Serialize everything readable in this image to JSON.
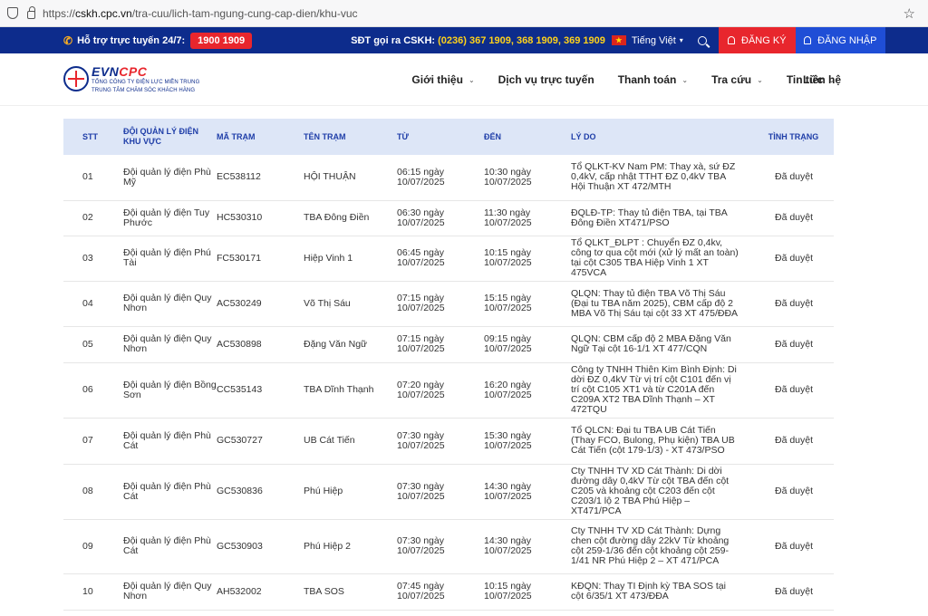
{
  "browser": {
    "url_prefix": "https://",
    "url_domain": "cskh.cpc.vn",
    "url_path": "/tra-cuu/lich-tam-ngung-cung-cap-dien/khu-vuc"
  },
  "topbar": {
    "support_label": "Hỗ trợ trực tuyến 24/7:",
    "hotline": "1900 1909",
    "cskh_label": "SĐT gọi ra CSKH:",
    "cskh_numbers": "(0236) 367 1909, 368 1909, 369 1909",
    "language": "Tiếng Việt",
    "register": "ĐĂNG KÝ",
    "login": "ĐĂNG NHẬP"
  },
  "header": {
    "logo_evn": "EVN",
    "logo_cpc": "CPC",
    "logo_line1": "TỔNG CÔNG TY ĐIỆN LỰC MIỀN TRUNG",
    "logo_line2": "TRUNG TÂM CHĂM SÓC KHÁCH HÀNG",
    "nav": [
      "Giới thiệu",
      "Dịch vụ trực tuyến",
      "Thanh toán",
      "Tra cứu",
      "Tin tức",
      "Liên hệ"
    ]
  },
  "table": {
    "headers": {
      "stt": "STT",
      "doi": "ĐỘI QUẢN LÝ ĐIỆN KHU VỰC",
      "ma": "MÃ TRẠM",
      "ten": "TÊN TRẠM",
      "tu": "TỪ",
      "den": "ĐẾN",
      "ly_do": "LÝ DO",
      "tinh_trang": "TÌNH TRẠNG"
    },
    "rows": [
      {
        "stt": "01",
        "doi": "Đội quản lý điện Phù Mỹ",
        "ma": "EC538112",
        "ten": "HỘI THUẬN",
        "tu": "06:15 ngày 10/07/2025",
        "den": "10:30 ngày 10/07/2025",
        "ly_do": "Tổ QLKT-KV Nam PM: Thay xà, sứ ĐZ 0,4kV, cấp nhật TTHT ĐZ 0,4kV TBA Hội Thuận XT 472/MTH",
        "tinh_trang": "Đã duyệt"
      },
      {
        "stt": "02",
        "doi": "Đội quản lý điện Tuy Phước",
        "ma": "HC530310",
        "ten": "TBA Đông Điền",
        "tu": "06:30 ngày 10/07/2025",
        "den": "11:30 ngày 10/07/2025",
        "ly_do": "ĐQLĐ-TP: Thay tủ điện TBA, tại TBA Đông Điền XT471/PSO",
        "tinh_trang": "Đã duyệt"
      },
      {
        "stt": "03",
        "doi": "Đội quản lý điện Phú Tài",
        "ma": "FC530171",
        "ten": "Hiệp Vinh 1",
        "tu": "06:45 ngày 10/07/2025",
        "den": "10:15 ngày 10/07/2025",
        "ly_do": "Tổ QLKT_ĐLPT : Chuyển ĐZ 0,4kv, công tơ qua cột mới (xử lý mất an toàn) tại cột C305 TBA Hiệp Vinh 1 XT 475VCA",
        "tinh_trang": "Đã duyệt"
      },
      {
        "stt": "04",
        "doi": "Đội quản lý điện Quy Nhơn",
        "ma": "AC530249",
        "ten": "Võ Thị Sáu",
        "tu": "07:15 ngày 10/07/2025",
        "den": "15:15 ngày 10/07/2025",
        "ly_do": "QLQN: Thay tủ điện TBA Võ Thị Sáu (Đại tu TBA năm 2025), CBM cấp độ 2 MBA Võ Thị Sáu tại cột 33 XT 475/ĐĐA",
        "tinh_trang": "Đã duyệt"
      },
      {
        "stt": "05",
        "doi": "Đội quản lý điện Quy Nhơn",
        "ma": "AC530898",
        "ten": "Đặng Văn Ngữ",
        "tu": "07:15 ngày 10/07/2025",
        "den": "09:15 ngày 10/07/2025",
        "ly_do": "QLQN: CBM cấp độ 2 MBA Đặng Văn Ngữ Tại cột 16-1/1 XT 477/CQN",
        "tinh_trang": "Đã duyệt"
      },
      {
        "stt": "06",
        "doi": "Đội quản lý điện Bồng Sơn",
        "ma": "CC535143",
        "ten": "TBA Dĩnh Thạnh",
        "tu": "07:20 ngày 10/07/2025",
        "den": "16:20 ngày 10/07/2025",
        "ly_do": "Công ty TNHH Thiên Kim Bình Định: Di dời ĐZ 0,4kV Từ vị trí cột C101 đến vị trí cột C105 XT1 và từ C201A đến C209A XT2 TBA Dĩnh Thạnh – XT 472TQU",
        "tinh_trang": "Đã duyệt"
      },
      {
        "stt": "07",
        "doi": "Đội quản lý điện Phù Cát",
        "ma": "GC530727",
        "ten": "UB Cát Tiến",
        "tu": "07:30 ngày 10/07/2025",
        "den": "15:30 ngày 10/07/2025",
        "ly_do": "Tổ QLCN: Đại tu TBA UB Cát Tiến (Thay FCO, Bulong, Phụ kiện) TBA UB Cát Tiến (cột 179-1/3) - XT 473/PSO",
        "tinh_trang": "Đã duyệt"
      },
      {
        "stt": "08",
        "doi": "Đội quản lý điện Phù Cát",
        "ma": "GC530836",
        "ten": "Phú Hiệp",
        "tu": "07:30 ngày 10/07/2025",
        "den": "14:30 ngày 10/07/2025",
        "ly_do": "Cty TNHH TV XD Cát Thành: Di dời đường dây 0,4kV Từ cột TBA đến cột C205 và khoảng cột C203 đến cột C203/1 lộ 2 TBA Phú Hiệp – XT471/PCA",
        "tinh_trang": "Đã duyệt"
      },
      {
        "stt": "09",
        "doi": "Đội quản lý điện Phù Cát",
        "ma": "GC530903",
        "ten": "Phú Hiệp 2",
        "tu": "07:30 ngày 10/07/2025",
        "den": "14:30 ngày 10/07/2025",
        "ly_do": "Cty TNHH TV XD Cát Thành: Dựng chen cột đường dây 22kV Từ khoảng cột 259-1/36 đến cột khoảng cột 259-1/41 NR Phú Hiệp 2 – XT 471/PCA",
        "tinh_trang": "Đã duyệt"
      },
      {
        "stt": "10",
        "doi": "Đội quản lý điện Quy Nhơn",
        "ma": "AH532002",
        "ten": "TBA SOS",
        "tu": "07:45 ngày 10/07/2025",
        "den": "10:15 ngày 10/07/2025",
        "ly_do": "KĐQN: Thay TI Định kỳ TBA SOS tại cột 6/35/1 XT 473/ĐĐA",
        "tinh_trang": "Đã duyệt"
      }
    ]
  }
}
